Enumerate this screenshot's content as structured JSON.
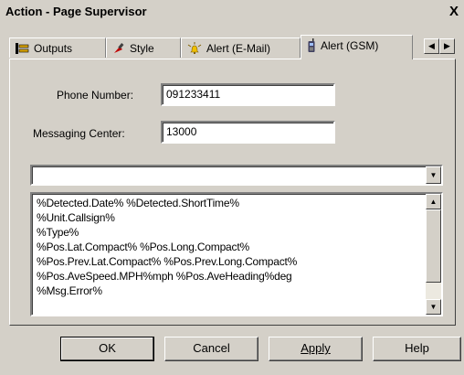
{
  "window": {
    "title": "Action - Page Supervisor",
    "close_label": "X"
  },
  "tabs": [
    {
      "label": "Outputs",
      "icon": "outputs-icon",
      "active": false
    },
    {
      "label": "Style",
      "icon": "style-icon",
      "active": false
    },
    {
      "label": "Alert (E-Mail)",
      "icon": "alert-email-icon",
      "active": false
    },
    {
      "label": "Alert (GSM)",
      "icon": "phone-icon",
      "active": true
    }
  ],
  "form": {
    "phone_label": "Phone Number:",
    "phone_value": "091233411",
    "messaging_label": "Messaging Center:",
    "messaging_value": "13000",
    "template_select_value": ""
  },
  "message_lines": [
    "%Detected.Date% %Detected.ShortTime%",
    "%Unit.Callsign%",
    "%Type%",
    "%Pos.Lat.Compact% %Pos.Long.Compact%",
    "%Pos.Prev.Lat.Compact% %Pos.Prev.Long.Compact%",
    "%Pos.AveSpeed.MPH%mph %Pos.AveHeading%deg",
    "%Msg.Error%"
  ],
  "buttons": {
    "ok": "OK",
    "cancel": "Cancel",
    "apply": "Apply",
    "help": "Help"
  },
  "colors": {
    "dialog_bg": "#d4d0c8",
    "field_bg": "#ffffff"
  }
}
